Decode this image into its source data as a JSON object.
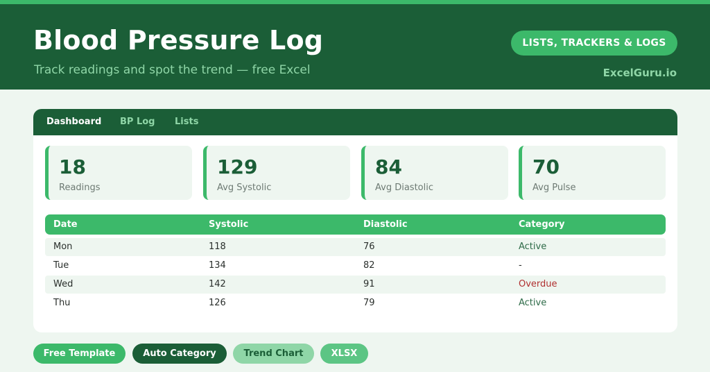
{
  "header": {
    "title": "Blood Pressure Log",
    "subtitle": "Track readings and spot the trend — free Excel",
    "category_pill": "LISTS, TRACKERS & LOGS",
    "brand": "ExcelGuru.io"
  },
  "tabs": [
    {
      "label": "Dashboard",
      "active": true
    },
    {
      "label": "BP Log",
      "active": false
    },
    {
      "label": "Lists",
      "active": false
    }
  ],
  "kpis": [
    {
      "value": "18",
      "label": "Readings"
    },
    {
      "value": "129",
      "label": "Avg Systolic"
    },
    {
      "value": "84",
      "label": "Avg Diastolic"
    },
    {
      "value": "70",
      "label": "Avg Pulse"
    }
  ],
  "table": {
    "columns": [
      "Date",
      "Systolic",
      "Diastolic",
      "Category"
    ],
    "rows": [
      {
        "date": "Mon",
        "systolic": "118",
        "diastolic": "76",
        "category": "Active"
      },
      {
        "date": "Tue",
        "systolic": "134",
        "diastolic": "82",
        "category": "-"
      },
      {
        "date": "Wed",
        "systolic": "142",
        "diastolic": "91",
        "category": "Overdue"
      },
      {
        "date": "Thu",
        "systolic": "126",
        "diastolic": "79",
        "category": "Active"
      }
    ]
  },
  "tags": [
    {
      "label": "Free Template"
    },
    {
      "label": "Auto Category"
    },
    {
      "label": "Trend Chart"
    },
    {
      "label": "XLSX"
    }
  ],
  "colors": {
    "dark_green": "#1b5e37",
    "accent_green": "#3cb96a",
    "light_mint": "#8fd6a7",
    "background": "#eef6f0",
    "overdue_red": "#b03030"
  }
}
